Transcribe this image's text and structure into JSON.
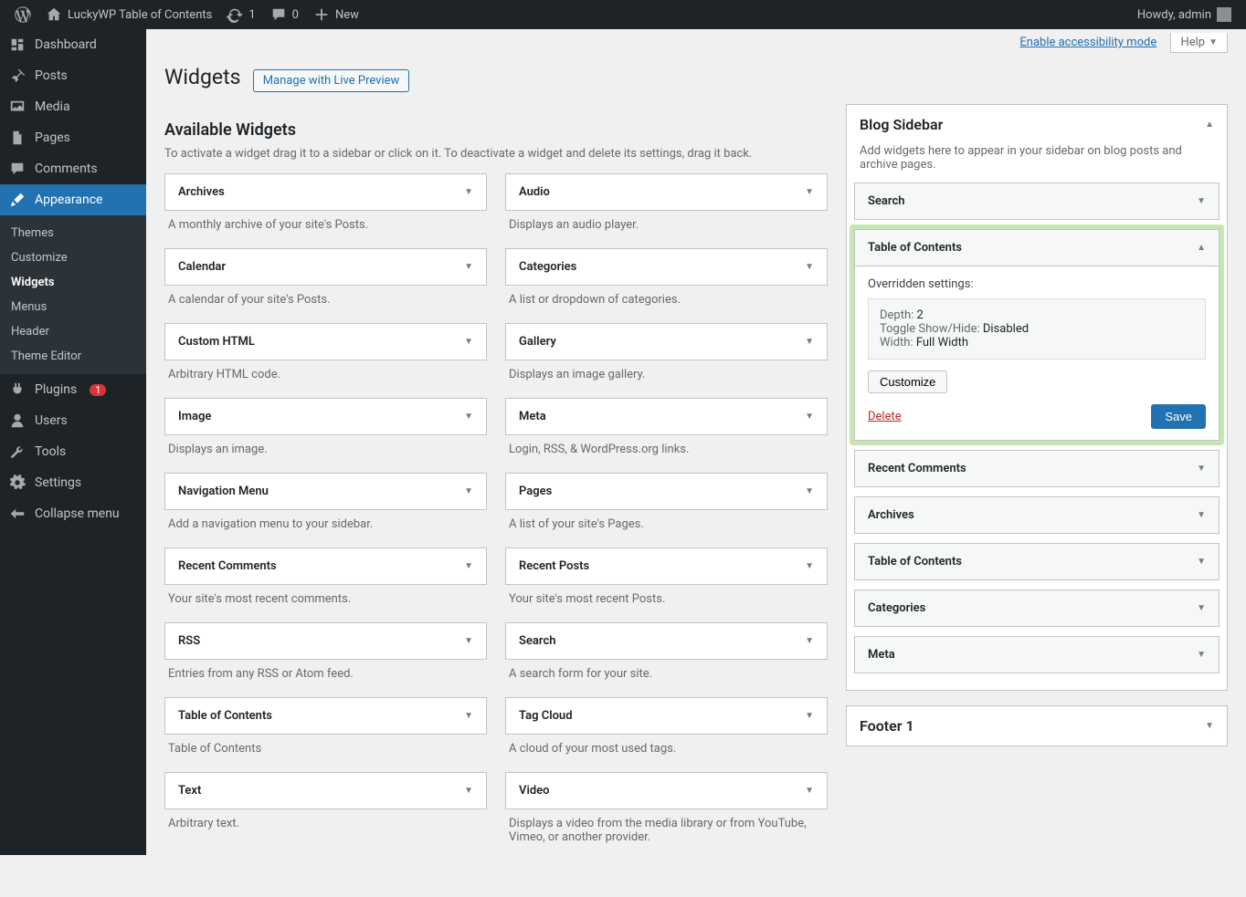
{
  "adminbar": {
    "site_name": "LuckyWP Table of Contents",
    "updates_count": "1",
    "comments_count": "0",
    "new_label": "New",
    "howdy": "Howdy, admin"
  },
  "menu": {
    "items": [
      {
        "label": "Dashboard",
        "icon": "dashboard"
      },
      {
        "label": "Posts",
        "icon": "pin"
      },
      {
        "label": "Media",
        "icon": "media"
      },
      {
        "label": "Pages",
        "icon": "page"
      },
      {
        "label": "Comments",
        "icon": "comment"
      },
      {
        "label": "Appearance",
        "icon": "brush",
        "current": true
      },
      {
        "label": "Plugins",
        "icon": "plug",
        "badge": "1"
      },
      {
        "label": "Users",
        "icon": "user"
      },
      {
        "label": "Tools",
        "icon": "wrench"
      },
      {
        "label": "Settings",
        "icon": "gear"
      },
      {
        "label": "Collapse menu",
        "icon": "collapse"
      }
    ],
    "submenu": [
      "Themes",
      "Customize",
      "Widgets",
      "Menus",
      "Header",
      "Theme Editor"
    ],
    "submenu_current_index": 2
  },
  "screen": {
    "accessibility_link": "Enable accessibility mode",
    "help_label": "Help"
  },
  "page": {
    "title": "Widgets",
    "action_label": "Manage with Live Preview",
    "available_heading": "Available Widgets",
    "available_desc": "To activate a widget drag it to a sidebar or click on it. To deactivate a widget and delete its settings, drag it back."
  },
  "available_widgets": [
    {
      "name": "Archives",
      "desc": "A monthly archive of your site's Posts."
    },
    {
      "name": "Audio",
      "desc": "Displays an audio player."
    },
    {
      "name": "Calendar",
      "desc": "A calendar of your site's Posts."
    },
    {
      "name": "Categories",
      "desc": "A list or dropdown of categories."
    },
    {
      "name": "Custom HTML",
      "desc": "Arbitrary HTML code."
    },
    {
      "name": "Gallery",
      "desc": "Displays an image gallery."
    },
    {
      "name": "Image",
      "desc": "Displays an image."
    },
    {
      "name": "Meta",
      "desc": "Login, RSS, & WordPress.org links."
    },
    {
      "name": "Navigation Menu",
      "desc": "Add a navigation menu to your sidebar."
    },
    {
      "name": "Pages",
      "desc": "A list of your site's Pages."
    },
    {
      "name": "Recent Comments",
      "desc": "Your site's most recent comments."
    },
    {
      "name": "Recent Posts",
      "desc": "Your site's most recent Posts."
    },
    {
      "name": "RSS",
      "desc": "Entries from any RSS or Atom feed."
    },
    {
      "name": "Search",
      "desc": "A search form for your site."
    },
    {
      "name": "Table of Contents",
      "desc": "Table of Contents"
    },
    {
      "name": "Tag Cloud",
      "desc": "A cloud of your most used tags."
    },
    {
      "name": "Text",
      "desc": "Arbitrary text."
    },
    {
      "name": "Video",
      "desc": "Displays a video from the media library or from YouTube, Vimeo, or another provider."
    }
  ],
  "sidebar_areas": [
    {
      "title": "Blog Sidebar",
      "desc": "Add widgets here to appear in your sidebar on blog posts and archive pages.",
      "widgets": [
        {
          "title": "Search"
        },
        {
          "title": "Table of Contents",
          "open": true
        },
        {
          "title": "Recent Comments"
        },
        {
          "title": "Archives"
        },
        {
          "title": "Table of Contents"
        },
        {
          "title": "Categories"
        },
        {
          "title": "Meta"
        }
      ]
    },
    {
      "title": "Footer 1"
    }
  ],
  "toc_widget": {
    "overridden_label": "Overridden settings:",
    "settings": [
      {
        "k": "Depth:",
        "v": "2"
      },
      {
        "k": "Toggle Show/Hide:",
        "v": "Disabled"
      },
      {
        "k": "Width:",
        "v": "Full Width"
      }
    ],
    "customize_label": "Customize",
    "delete_label": "Delete",
    "save_label": "Save"
  }
}
